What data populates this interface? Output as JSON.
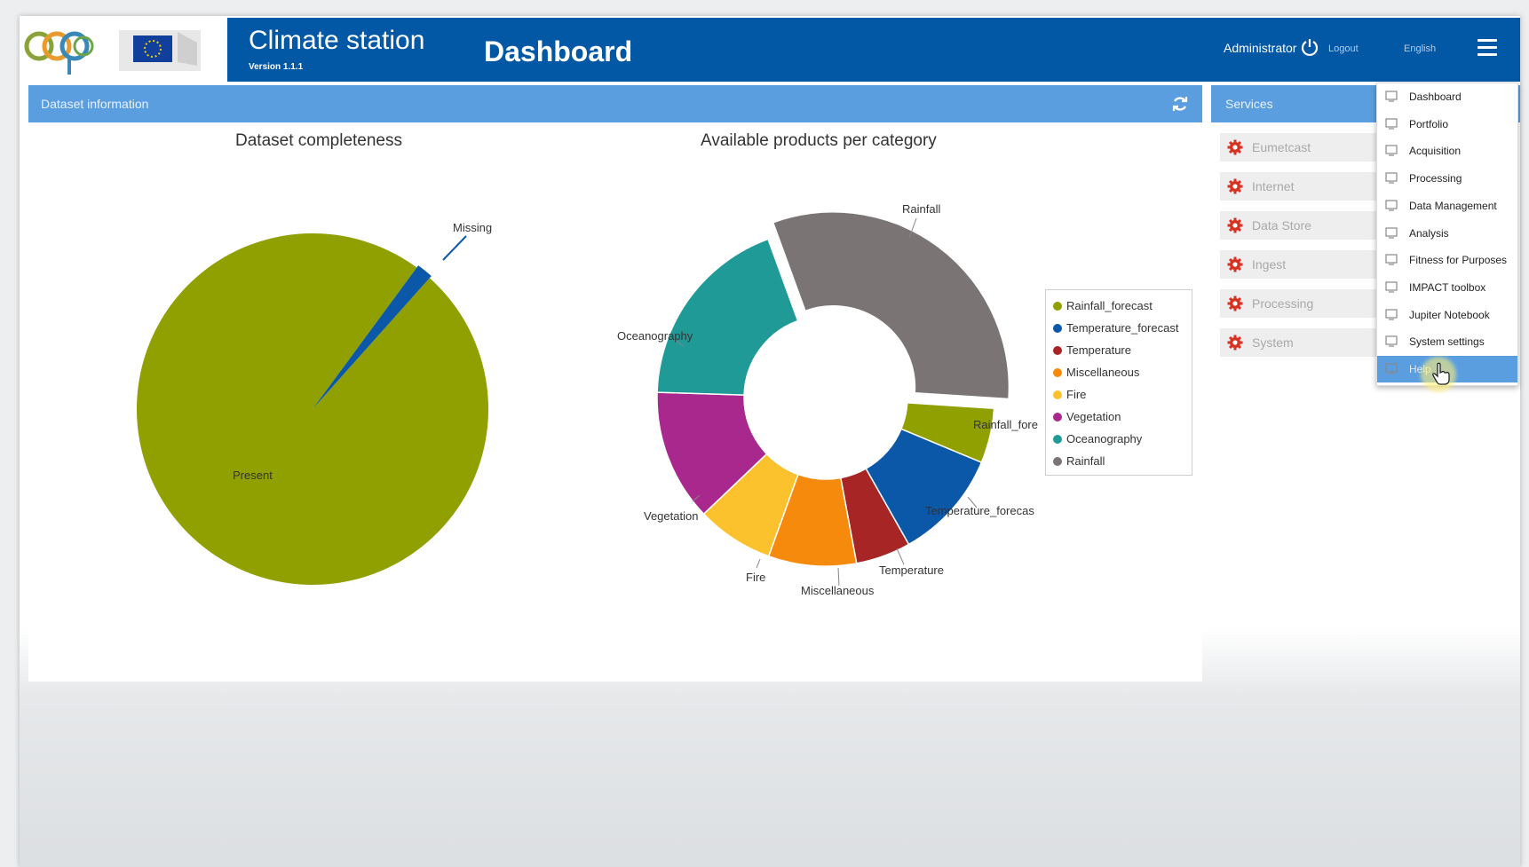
{
  "header": {
    "app_title": "Climate station",
    "version": "Version 1.1.1",
    "page_title": "Dashboard",
    "user": "Administrator",
    "logout": "Logout",
    "language": "English",
    "brand_color": "#0358a5"
  },
  "dataset_panel": {
    "title": "Dataset information",
    "refresh_icon": "refresh-icon"
  },
  "completeness_chart": {
    "title": "Dataset completeness",
    "slice_labels": [
      "Missing",
      "Present"
    ]
  },
  "products_chart": {
    "title": "Available products per category",
    "slice_labels": [
      "Rainfall",
      "Oceanography",
      "Vegetation",
      "Fire",
      "Miscellaneous",
      "Temperature",
      "Temperature_forecas",
      "Rainfall_fore"
    ]
  },
  "legend": [
    {
      "label": "Rainfall_forecast",
      "color": "#8fa000"
    },
    {
      "label": "Temperature_forecast",
      "color": "#0b57a8"
    },
    {
      "label": "Temperature",
      "color": "#a72525"
    },
    {
      "label": "Miscellaneous",
      "color": "#f58a0c"
    },
    {
      "label": "Fire",
      "color": "#fbc22e"
    },
    {
      "label": "Vegetation",
      "color": "#a8288e"
    },
    {
      "label": "Oceanography",
      "color": "#1f9a97"
    },
    {
      "label": "Rainfall",
      "color": "#7b7474"
    }
  ],
  "services": {
    "title": "Services",
    "items": [
      "Eumetcast",
      "Internet",
      "Data Store",
      "Ingest",
      "Processing",
      "System"
    ]
  },
  "menu": {
    "items": [
      {
        "label": "Dashboard",
        "icon": "monitor-icon"
      },
      {
        "label": "Portfolio",
        "icon": "portfolio-icon"
      },
      {
        "label": "Acquisition",
        "icon": "acquisition-icon"
      },
      {
        "label": "Processing",
        "icon": "processing-icon"
      },
      {
        "label": "Data Management",
        "icon": "sitemap-icon"
      },
      {
        "label": "Analysis",
        "icon": "bar-chart-icon"
      },
      {
        "label": "Fitness for Purposes",
        "icon": "line-chart-icon"
      },
      {
        "label": "IMPACT toolbox",
        "icon": "database-icon"
      },
      {
        "label": "Jupiter Notebook",
        "icon": "notebook-icon"
      },
      {
        "label": "System settings",
        "icon": "settings-icon"
      },
      {
        "label": "Help",
        "icon": "help-icon"
      }
    ],
    "active_index": 10
  },
  "chart_data": [
    {
      "type": "pie",
      "title": "Dataset completeness",
      "categories": [
        "Present",
        "Missing"
      ],
      "values": [
        98.5,
        1.5
      ],
      "colors": [
        "#8fa000",
        "#0b57a8"
      ]
    },
    {
      "type": "pie",
      "title": "Available products per category",
      "categories": [
        "Rainfall",
        "Rainfall_forecast",
        "Temperature_forecast",
        "Temperature",
        "Miscellaneous",
        "Fire",
        "Vegetation",
        "Oceanography"
      ],
      "values": [
        30,
        5,
        10,
        5,
        8,
        7,
        12,
        18
      ],
      "colors": [
        "#7b7474",
        "#8fa000",
        "#0b57a8",
        "#a72525",
        "#f58a0c",
        "#fbc22e",
        "#a8288e",
        "#1f9a97"
      ]
    }
  ]
}
